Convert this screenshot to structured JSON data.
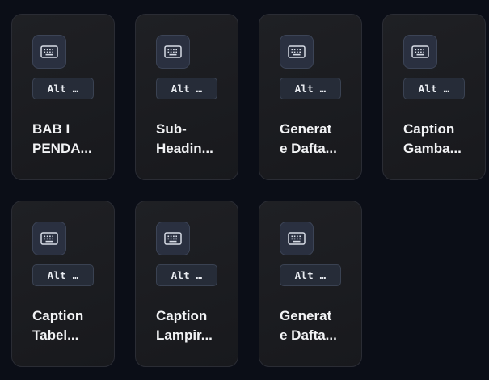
{
  "cards": [
    {
      "shortcut": "Alt …",
      "label_line1": "BAB I",
      "label_line2": "PENDA...",
      "icon": "keyboard-icon"
    },
    {
      "shortcut": "Alt …",
      "label_line1": "Sub-",
      "label_line2": "Headin...",
      "icon": "keyboard-icon"
    },
    {
      "shortcut": "Alt …",
      "label_line1": "Generat",
      "label_line2": "e Dafta...",
      "icon": "keyboard-icon"
    },
    {
      "shortcut": "Alt …",
      "label_line1": "Caption",
      "label_line2": "Gamba...",
      "icon": "keyboard-icon"
    },
    {
      "shortcut": "Alt …",
      "label_line1": "Caption",
      "label_line2": "Tabel...",
      "icon": "keyboard-icon"
    },
    {
      "shortcut": "Alt …",
      "label_line1": "Caption",
      "label_line2": "Lampir...",
      "icon": "keyboard-icon"
    },
    {
      "shortcut": "Alt …",
      "label_line1": "Generat",
      "label_line2": "e Dafta...",
      "icon": "keyboard-icon"
    }
  ],
  "colors": {
    "background": "#0b0e17",
    "card": "#1c1d21",
    "icon_box": "#2a3040",
    "text": "#f2f3f5"
  }
}
